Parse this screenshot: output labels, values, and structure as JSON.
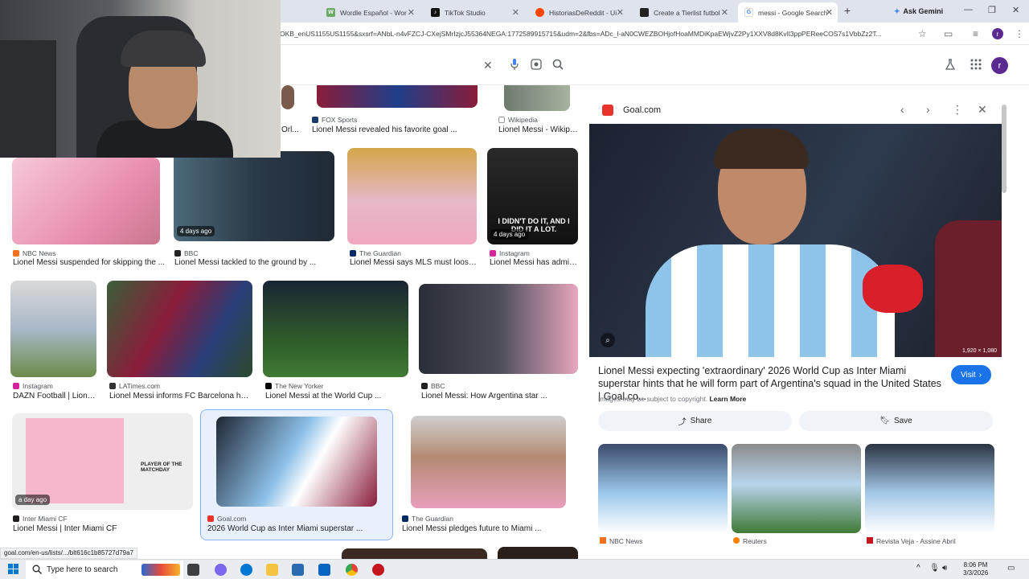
{
  "browser": {
    "tabs": [
      {
        "label": "Wordle Español - Wor",
        "color": "#6aaa64",
        "letter": "W"
      },
      {
        "label": "TikTok Studio",
        "color": "#111111",
        "letter": "♪"
      },
      {
        "label": "HistoriasDeReddit - Ui",
        "color": "#ff4500",
        "letter": ""
      },
      {
        "label": "Create a Tierlist futbol",
        "color": "#222222",
        "letter": ""
      },
      {
        "label": "messi - Google Search",
        "color": "#4285f4",
        "letter": "G"
      }
    ],
    "new_tab": "+",
    "gemini_label": "Ask Gemini",
    "url": "OKB_enUS1155US1155&sxsrf=ANbL-n4vFZCJ-CXejSMrIzjcJ55364NEGA:1772589915715&udm=2&fbs=ADc_l-aN0CWEZBOHjofHoaMMDiKpaEWjvZ2Py1XXV8d8KvIl3ppPEReeCOS7s1VbbZz2T...",
    "profile_initial": "r"
  },
  "search": {
    "clear_icon": "✕",
    "profile_initial": "r"
  },
  "results": [
    {
      "source": "FOX Sports",
      "caption": "Lionel Messi revealed his favorite goal ...",
      "color": "#1b3a6b"
    },
    {
      "source": "Wikipedia",
      "caption": "Lionel Messi - Wikipe...",
      "color": "#888888"
    },
    {
      "source": "NBC News",
      "caption": "Lionel Messi suspended for skipping the ...",
      "color": "#f37021",
      "age": ""
    },
    {
      "source": "BBC",
      "caption": "Lionel Messi tackled to the ground by ...",
      "color": "#222222",
      "age": "4 days ago"
    },
    {
      "source": "The Guardian",
      "caption": "Lionel Messi says MLS must loose...",
      "color": "#052962",
      "age": ""
    },
    {
      "source": "Instagram",
      "caption": "Lionel Messi has admit...",
      "color": "#d6249f",
      "age": "4 days ago"
    },
    {
      "source": "Instagram",
      "caption": "DAZN Football | Lionel...",
      "color": "#d6249f"
    },
    {
      "source": "LATimes.com",
      "caption": "Lionel Messi informs FC Barcelona he ...",
      "color": "#333333"
    },
    {
      "source": "The New Yorker",
      "caption": "Lionel Messi at the World Cup ...",
      "color": "#000000"
    },
    {
      "source": "BBC",
      "caption": "Lionel Messi: How Argentina star ...",
      "color": "#222222"
    },
    {
      "source": "Inter Miami CF",
      "caption": "Lionel Messi | Inter Miami CF",
      "color": "#231f20",
      "age": "a day ago"
    },
    {
      "source": "Goal.com",
      "caption": "2026 World Cup as Inter Miami superstar ...",
      "color": "#e8322c"
    },
    {
      "source": "The Guardian",
      "caption": "Lionel Messi pledges future to Miami ...",
      "color": "#052962"
    }
  ],
  "partial_caption": "Orl...",
  "thumb_text": {
    "didnt_do_it": "I DIDN'T DO IT, AND I",
    "did_it_a_lot": "DID IT A LOT.",
    "player_of_matchday": "PLAYER OF THE MATCHDAY"
  },
  "preview": {
    "source": "Goal.com",
    "dimensions": "1,920 × 1,080",
    "title": "Lionel Messi expecting 'extraordinary' 2026 World Cup as Inter Miami superstar hints that he will form part of Argentina's squad in the United States | Goal.co...",
    "visit_label": "Visit",
    "copyright_text": "Images may be subject to copyright.",
    "learn_more": "Learn More",
    "share_label": "Share",
    "save_label": "Save",
    "related": [
      {
        "source": "NBC News",
        "color": "#f37021"
      },
      {
        "source": "Reuters",
        "color": "#ff8000"
      },
      {
        "source": "Revista Veja - Assine Abril",
        "color": "#c4161c"
      }
    ]
  },
  "status_url": "goal.com/en-us/lists/.../blt616c1b85727d79a7",
  "taskbar": {
    "search_placeholder": "Type here to search",
    "time": "8:06 PM",
    "date": "3/3/2026"
  }
}
